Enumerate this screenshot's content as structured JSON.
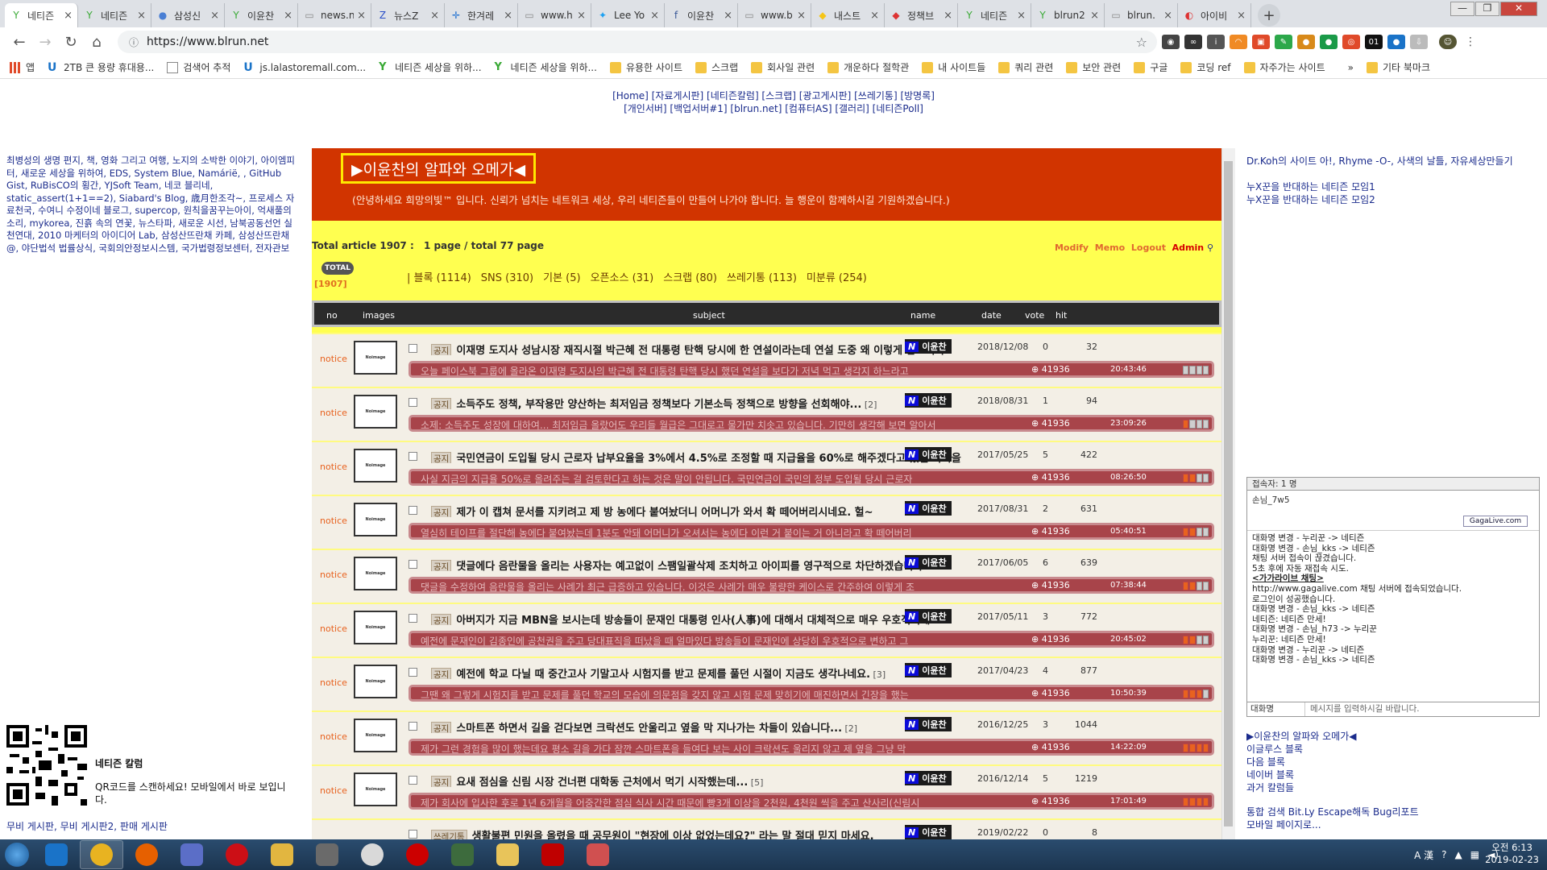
{
  "browser": {
    "tabs": [
      {
        "title": "네티즌",
        "color": "#39a935",
        "glyph": "Y"
      },
      {
        "title": "네티즌",
        "color": "#39a935",
        "glyph": "Y"
      },
      {
        "title": "삼성신",
        "color": "#4a7fd4",
        "glyph": "●"
      },
      {
        "title": "이윤찬",
        "color": "#39a935",
        "glyph": "Y"
      },
      {
        "title": "news.n",
        "color": "#888",
        "glyph": "▭"
      },
      {
        "title": "뉴스Z",
        "color": "#2a4fc8",
        "glyph": "Z"
      },
      {
        "title": "한겨레",
        "color": "#1e6fd0",
        "glyph": "✛"
      },
      {
        "title": "www.h",
        "color": "#888",
        "glyph": "▭"
      },
      {
        "title": "Lee Yo",
        "color": "#1da1f2",
        "glyph": "✦"
      },
      {
        "title": "이윤찬",
        "color": "#3b5998",
        "glyph": "f"
      },
      {
        "title": "www.b",
        "color": "#888",
        "glyph": "▭"
      },
      {
        "title": "내스트",
        "color": "#f5c518",
        "glyph": "◆"
      },
      {
        "title": "정책브",
        "color": "#d33",
        "glyph": "◆"
      },
      {
        "title": "네티즌",
        "color": "#39a935",
        "glyph": "Y"
      },
      {
        "title": "blrun2",
        "color": "#39a935",
        "glyph": "Y"
      },
      {
        "title": "blrun.",
        "color": "#888",
        "glyph": "▭"
      },
      {
        "title": "아이비",
        "color": "#d33",
        "glyph": "◐"
      }
    ],
    "url": "https://www.blrun.net",
    "bookmarks": [
      "앱",
      "2TB 큰 용량 휴대용...",
      "검색어 추적",
      "js.lalastoremall.com...",
      "네티즌 세상을 위하...",
      "네티즌 세상을 위하...",
      "유용한 사이트",
      "스크랩",
      "회사일 관련",
      "개운하다 절학관",
      "내 사이트들",
      "쿼리 관련",
      "보안 관련",
      "구글",
      "코딩 ref",
      "자주가는 사이트",
      "»",
      "기타 북마크"
    ]
  },
  "topnav": {
    "line1": "[Home] [자료게시판] [네티즌칼럼] [스크랩] [광고게시판] [쓰레기통] [방명록]",
    "line2": "[개인서버] [백업서버#1] [blrun.net] [컴퓨터AS] [갤러리] [네티즌Poll]"
  },
  "left": {
    "links": "최병성의 생명 편지, 책, 영화 그리고 여행, 노지의 소박한 이야기, 아이엠피터, 새로운 세상을 위하여, EDS, System Blue, Namárië, , GitHub Gist, RuBisCO의 횡간, YJSoft Team, 네코 블리네, static_assert(1+1==2), Siabard's Blog, 歳月한조각~, 프로세스 자료천국, 수여니 수정이네 블로그, supercop, 원칙을꿈꾸는아이, 억새풀의 소리, mykorea, 진흙 속의 연꽃, 뉴스타파, 새로운 시선, 남북공동선언 실천연대, 2010 마케터의 아이디어 Lab, 삼성산뜨란채 카페, 삼성산뜨란채@, 야단법석 법률상식, 국회의안정보시스템, 국가법령정보센터, 전자관보",
    "qr_title": "네티즌 칼럼",
    "qr_text": "QR코드를 스캔하세요! 모바일에서 바로 보입니다.",
    "boards": "무비 게시판, 무비 게시판2, 판매 게시판"
  },
  "board": {
    "title": "▶이윤찬의 알파와 오메가◀",
    "greeting": "(안녕하세요 희망의빛™ 입니다. 신뢰가 넘치는 네트워크 세상, 우리 네티즌들이 만들어 나가야 합니다. 늘 행운이 함께하시길 기원하겠습니다.)",
    "total_label": "Total article 1907 :",
    "page_info": "1 page / total 77 page",
    "admin_links": [
      "Modify",
      "Memo",
      "Logout",
      "Admin"
    ],
    "total_badge": "TOTAL",
    "total_num": "[1907]",
    "categories": [
      "| 블록 (1114)",
      "SNS (310)",
      "기본 (5)",
      "오픈소스 (31)",
      "스크랩 (80)",
      "쓰레기통 (113)",
      "미분류 (254)"
    ],
    "headers": {
      "no": "no",
      "images": "images",
      "subject": "subject",
      "name": "name",
      "date": "date",
      "vote": "vote",
      "hit": "hit"
    },
    "rows": [
      {
        "no": "notice",
        "tag": "공지",
        "subject": "이재명 도지사 성남시장 재직시절 박근혜 전 대통령 탄핵 당시에 한 연설이라는데 연설 도중 왜 이렇게 잡소리가",
        "comments": "",
        "preview": "오늘 페이스북 그룹에 올라온 이재명 도지사의 박근혜 전 대통령 탄핵 당시 했던 연설을 보다가 저녁 먹고 생각지 하느라고",
        "name": "이윤찬",
        "date": "2018/12/08",
        "vote": "0",
        "hit": "32",
        "count": "41936",
        "time": "20:43:46",
        "bars": 0
      },
      {
        "no": "notice",
        "tag": "공지",
        "subject": "소득주도 정책, 부작용만 양산하는 최저임금 정책보다 기본소득 정책으로 방향을 선회해야...",
        "comments": " [2]",
        "preview": "소제: 소득주도 성장에 대하여... 최저임금 올랐어도 우리들 월급은 그대로고 물가만 치솟고 있습니다. 기만히 생각해 보면 알아서",
        "name": "이윤찬",
        "date": "2018/08/31",
        "vote": "1",
        "hit": "94",
        "count": "41936",
        "time": "23:09:26",
        "bars": 1
      },
      {
        "no": "notice",
        "tag": "공지",
        "subject": "국민연금이 도입될 당시 근로자 납부요율을 3%에서 4.5%로 조정할 때 지급율을 60%로 해주겠다고 했던 약속을",
        "comments": "",
        "preview": "사실 지금의 지급율 50%로 올려주는 걸 검토한다고 하는 것은 말이 안됩니다. 국민연금이 국민의 정부 도입될 당시 근로자",
        "name": "이윤찬",
        "date": "2017/05/25",
        "vote": "5",
        "hit": "422",
        "count": "41936",
        "time": "08:26:50",
        "bars": 2
      },
      {
        "no": "notice",
        "tag": "공지",
        "subject": "제가 이 캡쳐 문서를 지키려고 제 방 농에다 붙여놨더니 어머니가 와서 확 떼어버리시네요. 헐~",
        "comments": "",
        "preview": "열심히 테이프를 절단해 농에다 붙여놨는데 1분도 안돼 어머니가 오셔서는 농에다 이런 거 붙이는 거 아니라고 확 떼어버리",
        "name": "이윤찬",
        "date": "2017/08/31",
        "vote": "2",
        "hit": "631",
        "count": "41936",
        "time": "05:40:51",
        "bars": 2
      },
      {
        "no": "notice",
        "tag": "공지",
        "subject": "댓글에다 음란물을 올리는 사용자는 예고없이 스팸일괄삭제 조치하고 아이피를 영구적으로 차단하겠습니다...",
        "comments": "",
        "preview": "댓글을 수정하여 음란물을 올리는 사례가 최근 급증하고 있습니다. 이것은 사례가 매우 불량한 케이스로 간주하여 이렇게 조",
        "name": "이윤찬",
        "date": "2017/06/05",
        "vote": "6",
        "hit": "639",
        "count": "41936",
        "time": "07:38:44",
        "bars": 2
      },
      {
        "no": "notice",
        "tag": "공지",
        "subject": "아버지가 지금 MBN을 보시는데 방송들이 문재인 대통령 인사(人事)에 대해서 대체적으로 매우 우호적이네요...",
        "comments": "",
        "preview": "예전에 문재인이 김종인에 공천권을 주고 당대표직을 떠났을 때 얼마있다 방송들이 문재인에 상당히 우호적으로 변하고 그",
        "name": "이윤찬",
        "date": "2017/05/11",
        "vote": "3",
        "hit": "772",
        "count": "41936",
        "time": "20:45:02",
        "bars": 2
      },
      {
        "no": "notice",
        "tag": "공지",
        "subject": "예전에 학교 다닐 때 중간고사 기말고사 시험지를 받고 문제를 풀던 시절이 지금도 생각나네요.",
        "comments": " [3]",
        "preview": "그땐 왜 그렇게 시험지를 받고 문제를 풀던 학교의 모습에 의문점을 갖지 않고 시험 문제 맞히기에 매진하면서 긴장을 했는",
        "name": "이윤찬",
        "date": "2017/04/23",
        "vote": "4",
        "hit": "877",
        "count": "41936",
        "time": "10:50:39",
        "bars": 3
      },
      {
        "no": "notice",
        "tag": "공지",
        "subject": "스마트폰 하면서 길을 걷다보면 크락션도 안울리고 옆을 막 지나가는 차들이 있습니다...",
        "comments": " [2]",
        "preview": "제가 그런 경험을 많이 했는데요 평소 길을 가다 잠깐 스마트폰을 들여다 보는 사이 크락션도 울리지 않고 제 옆을 그냥 막",
        "name": "이윤찬",
        "date": "2016/12/25",
        "vote": "3",
        "hit": "1044",
        "count": "41936",
        "time": "14:22:09",
        "bars": 4
      },
      {
        "no": "notice",
        "tag": "공지",
        "subject": "요새 점심을 신림 시장 건너편 대학동 근처에서 먹기 시작했는데...",
        "comments": " [5]",
        "preview": "제가 회사에 입사한 후로 1년 6개월을 어중간한 점심 식사 시간 때문에 빵3개 이상을 2천원, 4천원 씩을 주고 산사리(신림시",
        "name": "이윤찬",
        "date": "2016/12/14",
        "vote": "5",
        "hit": "1219",
        "count": "41936",
        "time": "17:01:49",
        "bars": 4
      },
      {
        "no": "",
        "tag": "쓰레기통",
        "subject": "생활불편 민원을 올렸을 때 공무원이 \"현장에 이상 없었는데요?\" 라는 말 절대 믿지 마세요.",
        "comments": "",
        "preview": "",
        "name": "이윤찬",
        "date": "2019/02/22",
        "vote": "0",
        "hit": "8",
        "count": "",
        "time": "",
        "bars": 0
      }
    ]
  },
  "right": {
    "links1": [
      "Dr.Koh의 사이트 아!, Rhyme -O-, 사색의 날틀, 자유세상만들기",
      "",
      "누X꾼을 반대하는 네티즌 모임1",
      "누X꾼을 반대하는 네티즌 모임2"
    ],
    "chat": {
      "header": "접속자: 1 명",
      "user": "손님_7w5",
      "logo": "GagaLive.com",
      "log": [
        {
          "t": "대화명 변경 - 누리꾼 -> 네티즌",
          "u": false
        },
        {
          "t": "대화명 변경 - 손님_kks -> 네티즌",
          "u": false
        },
        {
          "t": "채팅 서버 접속이 끊겼습니다.",
          "u": false
        },
        {
          "t": "5초 후에 자동 재접속 시도.",
          "u": false
        },
        {
          "t": "<가가라이브 채팅>",
          "u": true
        },
        {
          "t": "http://www.gagalive.com 채팅 서버에 접속되었습니다.",
          "u": false
        },
        {
          "t": "로그인이 성공했습니다.",
          "u": false
        },
        {
          "t": "대화명 변경 - 손님_kks -> 네티즌",
          "u": false
        },
        {
          "t": "네티즌: 네티즌 만세!",
          "u": false
        },
        {
          "t": "대화명 변경 - 손님_h73 -> 누리꾼",
          "u": false
        },
        {
          "t": "누리꾼: 네티즌 만세!",
          "u": false
        },
        {
          "t": "대화명 변경 - 누리꾼 -> 네티즌",
          "u": false
        },
        {
          "t": "대화명 변경 - 손님_kks -> 네티즌",
          "u": false
        }
      ],
      "name_label": "대화명",
      "input_placeholder": "메시지를 입력하시길 바랍니다."
    },
    "links2": [
      "▶이윤찬의 알파와 오메가◀",
      "이글루스 블록",
      "다음 블록",
      "네이버 블록",
      "과거 칼럼들"
    ],
    "links3": [
      "통합 검색 Bit.Ly Escape해독 Bug리포트",
      "모바일 페이지로..."
    ]
  },
  "taskbar": {
    "apps": [
      {
        "name": "ie",
        "color": "#1a73c8"
      },
      {
        "name": "chrome",
        "color": "#e8b321"
      },
      {
        "name": "firefox",
        "color": "#e66000"
      },
      {
        "name": "app-s",
        "color": "#5b6ec7"
      },
      {
        "name": "opera",
        "color": "#cc0f16"
      },
      {
        "name": "editor",
        "color": "#e2b640"
      },
      {
        "name": "book",
        "color": "#6a6a6a"
      },
      {
        "name": "pokeball",
        "color": "#d9d9d9"
      },
      {
        "name": "record",
        "color": "#cc0000"
      },
      {
        "name": "app-green",
        "color": "#3d6b3d"
      },
      {
        "name": "explorer",
        "color": "#e8c45a"
      },
      {
        "name": "filezilla",
        "color": "#bf0000"
      },
      {
        "name": "app-red",
        "color": "#d05050"
      }
    ],
    "ime": "A 漢",
    "time": "오전 6:13",
    "date": "2019-02-23"
  }
}
